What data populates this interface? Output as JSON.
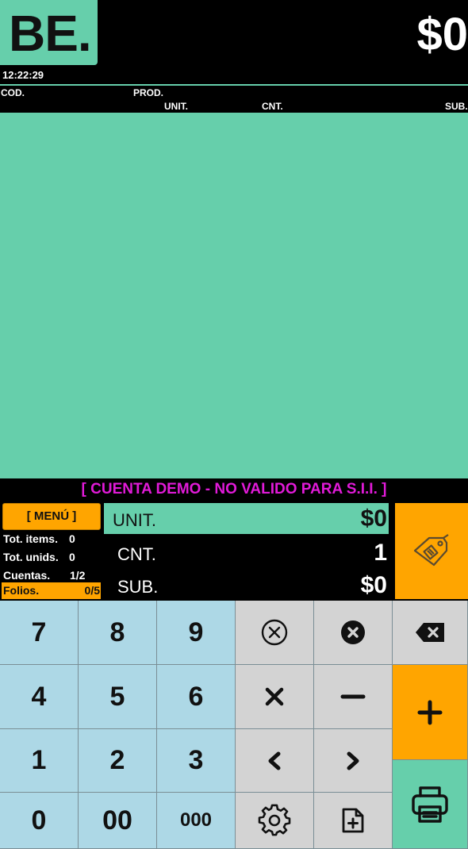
{
  "header": {
    "logo_text": "BE.",
    "total": "$0",
    "clock": "12:22:29"
  },
  "columns": {
    "cod": "COD.",
    "prod": "PROD.",
    "unit": "UNIT.",
    "cnt": "CNT.",
    "sub": "SUB."
  },
  "banner": "[ CUENTA DEMO - NO VALIDO PARA S.I.I. ]",
  "side": {
    "menu_label": "[ MENÚ ]",
    "tot_items_label": "Tot. items.",
    "tot_items_value": "0",
    "tot_unids_label": "Tot. unids.",
    "tot_unids_value": "0",
    "cuentas_label": "Cuentas.",
    "cuentas_value": "1/2",
    "folios_label": "Folios.",
    "folios_value": "0/5"
  },
  "entry": {
    "unit_label": "UNIT.",
    "unit_value": "$0",
    "cnt_label": "CNT.",
    "cnt_value": "1",
    "sub_label": "SUB.",
    "sub_value": "$0"
  },
  "keypad": {
    "k7": "7",
    "k8": "8",
    "k9": "9",
    "k4": "4",
    "k5": "5",
    "k6": "6",
    "k1": "1",
    "k2": "2",
    "k3": "3",
    "k0": "0",
    "k00": "00",
    "k000": "000"
  },
  "icons": {
    "tag": "price-tag-icon",
    "clear_circle": "clear-circle-icon",
    "remove_filled": "remove-filled-icon",
    "backspace": "backspace-icon",
    "multiply": "multiply-icon",
    "minus": "minus-icon",
    "plus": "plus-icon",
    "left": "chevron-left-icon",
    "right": "chevron-right-icon",
    "settings": "gear-icon",
    "add_doc": "add-document-icon",
    "print": "printer-icon"
  },
  "colors": {
    "accent_green": "#66cfab",
    "accent_orange": "#ffa500",
    "key_blue": "#add8e6",
    "key_gray": "#d3d3d3",
    "banner_magenta": "#e11ad8"
  }
}
